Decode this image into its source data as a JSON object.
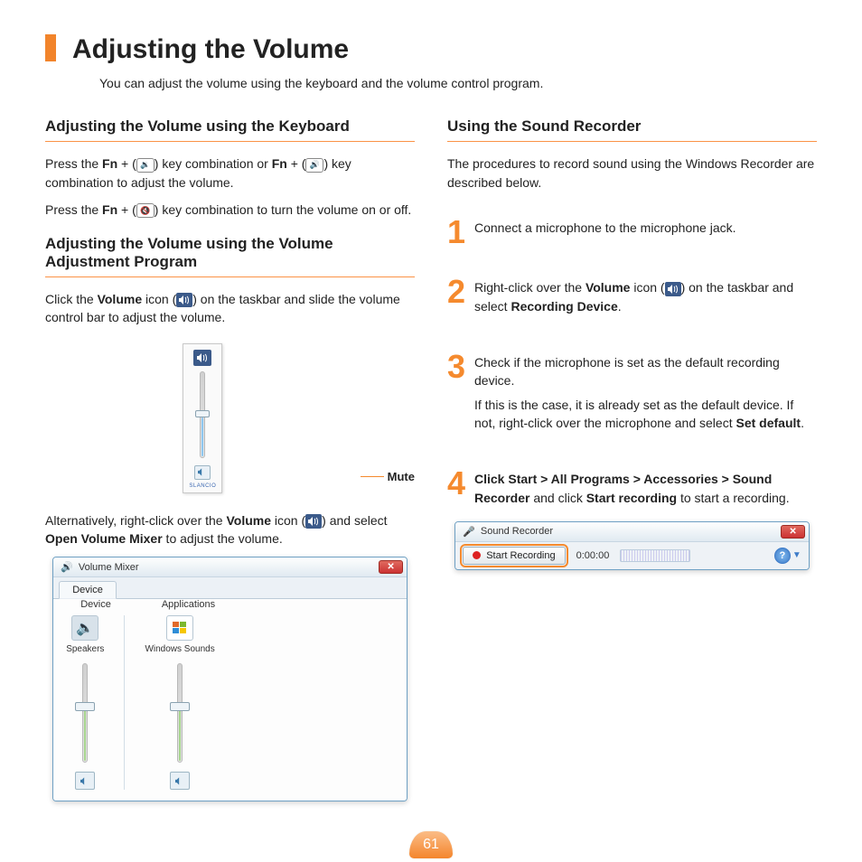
{
  "page_number": "61",
  "title": "Adjusting the Volume",
  "subtitle": "You can adjust the volume using the keyboard and the volume control program.",
  "left": {
    "h_keyboard": "Adjusting the Volume using the Keyboard",
    "p_kb_1a": "Press the ",
    "p_kb_1b": "Fn",
    "p_kb_1c": " + (",
    "p_kb_1d": ") key combination or ",
    "p_kb_1e": "Fn",
    "p_kb_1f": " + (",
    "p_kb_1g": ") key combination to adjust the volume.",
    "p_kb_2a": "Press the ",
    "p_kb_2b": "Fn",
    "p_kb_2c": " + (",
    "p_kb_2d": ") key combination to turn the volume on or off.",
    "h_program": "Adjusting the Volume using the Volume Adjustment Program",
    "p_prog_1a": "Click the ",
    "p_prog_1b": "Volume",
    "p_prog_1c": " icon (",
    "p_prog_1d": ") on the taskbar and slide the volume control bar to adjust the volume.",
    "mute_label": "Mute",
    "mini_brand": "SLANCIO",
    "p_alt_1a": "Alternatively, right-click over the ",
    "p_alt_1b": "Volume",
    "p_alt_1c": " icon (",
    "p_alt_1d": ") and select ",
    "p_alt_1e": "Open Volume Mixer",
    "p_alt_1f": " to adjust the volume.",
    "mixer": {
      "title": "Volume Mixer",
      "tab_device": "Device",
      "col_device": "Device",
      "col_apps": "Applications",
      "speakers": "Speakers",
      "winsounds": "Windows Sounds"
    }
  },
  "right": {
    "h_recorder": "Using the Sound Recorder",
    "intro": "The procedures to record sound using the Windows Recorder are described below.",
    "steps": {
      "1": "Connect a microphone to the microphone jack.",
      "2a": "Right-click over the ",
      "2b": "Volume",
      "2c": " icon (",
      "2d": ") on the taskbar and select ",
      "2e": "Recording Device",
      "2f": ".",
      "3a": "Check if the microphone is set as the default recording device.",
      "3b": "If this is the case, it is already set as the default device. If not, right-click over the microphone and select ",
      "3c": "Set default",
      "3d": ".",
      "4a": "Click Start > All Programs > Accessories > Sound Recorder",
      "4b": " and click ",
      "4c": "Start recording",
      "4d": " to start a recording."
    },
    "recorder": {
      "title": "Sound Recorder",
      "btn": "Start Recording",
      "time": "0:00:00"
    },
    "num1": "1",
    "num2": "2",
    "num3": "3",
    "num4": "4"
  }
}
